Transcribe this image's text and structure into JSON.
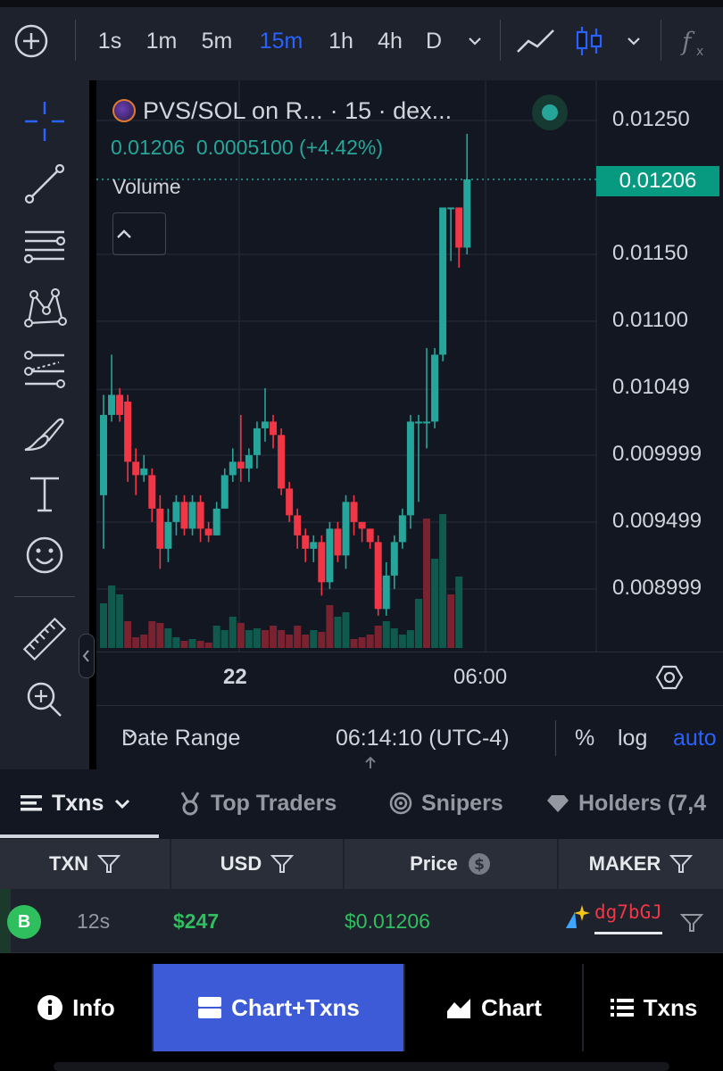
{
  "toolbar": {
    "intervals": [
      "1s",
      "1m",
      "5m",
      "15m",
      "1h",
      "4h",
      "D"
    ],
    "active_interval": "15m",
    "icons": [
      "plus-circle-icon",
      "chevron-down-icon",
      "line-chart-icon",
      "candlestick-icon",
      "chevron-down-icon",
      "function-icon"
    ]
  },
  "chart": {
    "legend": {
      "symbol": "PVS/SOL on R...",
      "meta": "· 15 · dex..."
    },
    "ohlc": {
      "close": "0.01206",
      "change": "0.0005100",
      "change_pct": "(+4.42%)"
    },
    "volume_label": "Volume",
    "price_axis": [
      "0.01250",
      "0.01150",
      "0.01100",
      "0.01049",
      "0.009999",
      "0.009499",
      "0.008999"
    ],
    "last_price": "0.01206",
    "time_axis": {
      "labels": [
        "22",
        "06:00"
      ]
    },
    "bottom": {
      "date_range": "Date Range",
      "clock": "06:14:10 (UTC-4)",
      "percent": "%",
      "log": "log",
      "auto": "auto"
    },
    "colors": {
      "up": "#26a69a",
      "down": "#f23645",
      "accent": "#2962ff",
      "background": "#131722"
    }
  },
  "chart_data": {
    "type": "candlestick",
    "price_axis_ticks": [
      0.0125,
      0.0115,
      0.011,
      0.01049,
      0.009999,
      0.009499,
      0.008999
    ],
    "last_price": 0.01206,
    "x_labels": [
      "22",
      "06:00"
    ],
    "candles": [
      [
        0.0097,
        0.0103,
        0.0093,
        0.01045
      ],
      [
        0.0103,
        0.01045,
        0.01025,
        0.01075
      ],
      [
        0.01045,
        0.0103,
        0.01025,
        0.0105
      ],
      [
        0.0104,
        0.00995,
        0.0098,
        0.01045
      ],
      [
        0.00995,
        0.00985,
        0.0097,
        0.01005
      ],
      [
        0.00985,
        0.0099,
        0.0098,
        0.01
      ],
      [
        0.00985,
        0.0096,
        0.0095,
        0.0099
      ],
      [
        0.0096,
        0.0093,
        0.00915,
        0.0097
      ],
      [
        0.0093,
        0.0095,
        0.0092,
        0.0096
      ],
      [
        0.0095,
        0.00965,
        0.0094,
        0.0097
      ],
      [
        0.00965,
        0.00945,
        0.0094,
        0.0097
      ],
      [
        0.00945,
        0.00965,
        0.0094,
        0.0097
      ],
      [
        0.00965,
        0.00945,
        0.00935,
        0.0097
      ],
      [
        0.00945,
        0.0094,
        0.00935,
        0.0095
      ],
      [
        0.0094,
        0.0096,
        0.0094,
        0.00965
      ],
      [
        0.0096,
        0.00985,
        0.0096,
        0.0099
      ],
      [
        0.00985,
        0.00995,
        0.0098,
        0.01005
      ],
      [
        0.00995,
        0.0099,
        0.0098,
        0.0103
      ],
      [
        0.0099,
        0.01,
        0.0098,
        0.01005
      ],
      [
        0.01,
        0.0102,
        0.0099,
        0.01025
      ],
      [
        0.0102,
        0.01025,
        0.0101,
        0.0105
      ],
      [
        0.01025,
        0.01015,
        0.01005,
        0.0103
      ],
      [
        0.01015,
        0.00975,
        0.0097,
        0.0102
      ],
      [
        0.00975,
        0.00955,
        0.0095,
        0.0098
      ],
      [
        0.00955,
        0.0094,
        0.0093,
        0.0096
      ],
      [
        0.0094,
        0.0093,
        0.0092,
        0.00945
      ],
      [
        0.0093,
        0.00935,
        0.0092,
        0.0094
      ],
      [
        0.00935,
        0.00905,
        0.00895,
        0.0094
      ],
      [
        0.00905,
        0.00945,
        0.009,
        0.0095
      ],
      [
        0.00945,
        0.00925,
        0.0092,
        0.0095
      ],
      [
        0.00925,
        0.00965,
        0.00915,
        0.0097
      ],
      [
        0.00965,
        0.0095,
        0.0094,
        0.0097
      ],
      [
        0.0095,
        0.00945,
        0.00935,
        0.0095
      ],
      [
        0.00945,
        0.00935,
        0.0093,
        0.00945
      ],
      [
        0.00935,
        0.00885,
        0.0088,
        0.0094
      ],
      [
        0.00885,
        0.0091,
        0.0088,
        0.0092
      ],
      [
        0.0091,
        0.00935,
        0.009,
        0.0094
      ],
      [
        0.00935,
        0.00955,
        0.0093,
        0.0096
      ],
      [
        0.00955,
        0.01025,
        0.00945,
        0.0103
      ],
      [
        0.01025,
        0.01025,
        0.00965,
        0.0103
      ],
      [
        0.01025,
        0.01025,
        0.01005,
        0.0108
      ],
      [
        0.01025,
        0.01075,
        0.0102,
        0.0108
      ],
      [
        0.01075,
        0.01185,
        0.0107,
        0.01185
      ],
      [
        0.01185,
        0.01185,
        0.01145,
        0.01185
      ],
      [
        0.01185,
        0.01155,
        0.0114,
        0.01185
      ],
      [
        0.01155,
        0.01206,
        0.0115,
        0.0124
      ]
    ],
    "volume": [
      [
        50,
        1
      ],
      [
        70,
        1
      ],
      [
        60,
        1
      ],
      [
        30,
        0
      ],
      [
        12,
        0
      ],
      [
        15,
        0
      ],
      [
        30,
        0
      ],
      [
        28,
        0
      ],
      [
        22,
        1
      ],
      [
        12,
        1
      ],
      [
        8,
        0
      ],
      [
        10,
        1
      ],
      [
        8,
        0
      ],
      [
        6,
        0
      ],
      [
        25,
        1
      ],
      [
        20,
        1
      ],
      [
        35,
        1
      ],
      [
        28,
        0
      ],
      [
        20,
        1
      ],
      [
        22,
        1
      ],
      [
        20,
        0
      ],
      [
        25,
        0
      ],
      [
        20,
        0
      ],
      [
        15,
        0
      ],
      [
        25,
        0
      ],
      [
        15,
        0
      ],
      [
        20,
        1
      ],
      [
        18,
        0
      ],
      [
        48,
        0
      ],
      [
        35,
        1
      ],
      [
        40,
        1
      ],
      [
        10,
        0
      ],
      [
        12,
        0
      ],
      [
        15,
        0
      ],
      [
        25,
        0
      ],
      [
        30,
        1
      ],
      [
        22,
        1
      ],
      [
        15,
        1
      ],
      [
        20,
        1
      ],
      [
        55,
        1
      ],
      [
        145,
        0
      ],
      [
        100,
        1
      ],
      [
        150,
        1
      ],
      [
        60,
        0
      ],
      [
        80,
        1
      ]
    ]
  },
  "txns": {
    "tabs": [
      {
        "label": "Txns",
        "icon": "list-icon",
        "active": true
      },
      {
        "label": "Top Traders",
        "icon": "medal-icon"
      },
      {
        "label": "Snipers",
        "icon": "target-icon"
      },
      {
        "label": "Holders (7,4",
        "icon": "diamond-icon"
      }
    ],
    "columns": [
      "TXN",
      "USD",
      "Price",
      "MAKER"
    ],
    "rows": [
      {
        "type": "B",
        "age": "12s",
        "usd": "$247",
        "price": "$0.01206",
        "maker": "dg7bGJ"
      }
    ]
  },
  "bottom_nav": [
    {
      "label": "Info",
      "icon": "info-icon"
    },
    {
      "label": "Chart+Txns",
      "icon": "split-view-icon",
      "active": true
    },
    {
      "label": "Chart",
      "icon": "area-chart-icon"
    },
    {
      "label": "Txns",
      "icon": "list-icon"
    }
  ]
}
